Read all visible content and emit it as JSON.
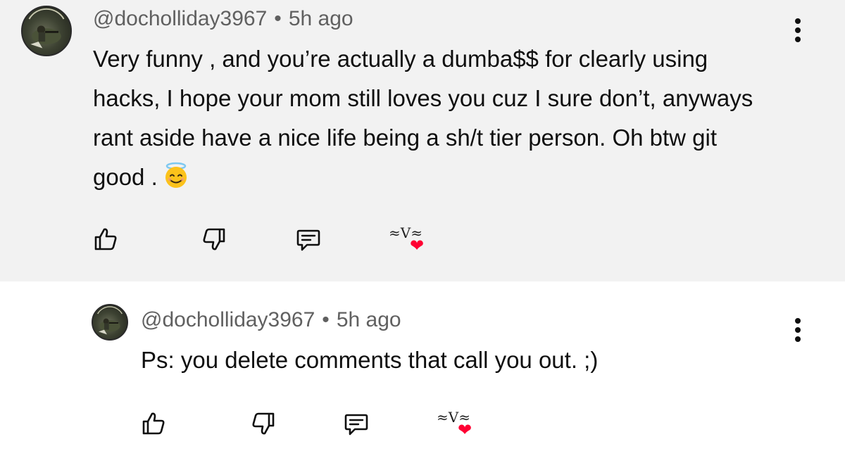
{
  "parent_comment": {
    "author": "@docholliday3967",
    "separator": "•",
    "time": "5h ago",
    "text": "Very funny , and you’re actually a dumba$$ for clearly using hacks, I hope your mom still loves you cuz I sure don’t, anyways rant aside have a nice life being a sh/t tier person. Oh btw git good .",
    "emoji_icon": "smiling-face-with-halo-icon"
  },
  "reply_comment": {
    "author": "@docholliday3967",
    "separator": "•",
    "time": "5h ago",
    "text": "Ps: you delete comments that call you out. ;)"
  },
  "colors": {
    "parent_background": "#f2f2f2",
    "meta_text": "#606060",
    "heart": "#ff0033"
  }
}
